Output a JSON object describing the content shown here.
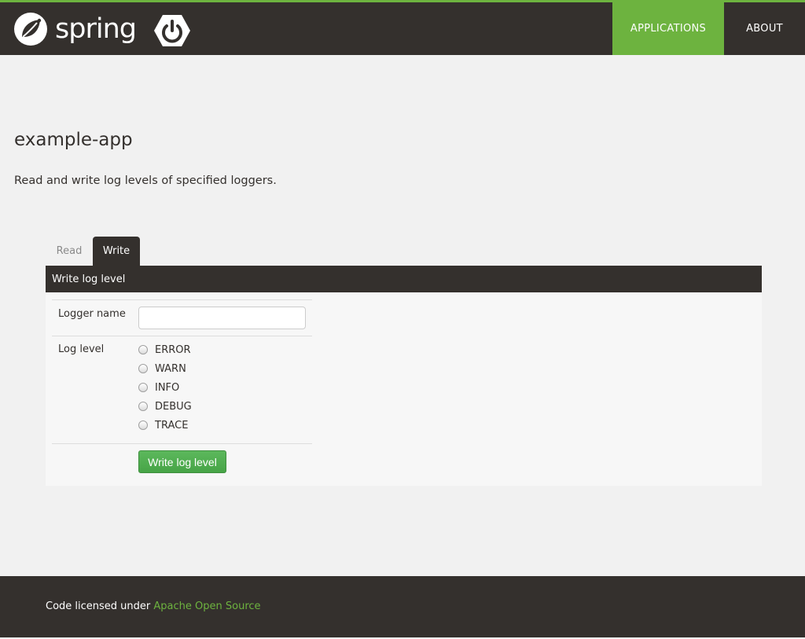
{
  "header": {
    "logo_text": "spring",
    "nav": {
      "applications": "APPLICATIONS",
      "about": "ABOUT"
    },
    "accent_color": "#6db33f",
    "bar_color": "#34302d",
    "icons": [
      "spring-leaf-icon",
      "power-icon"
    ]
  },
  "main": {
    "title": "example-app",
    "description": "Read and write log levels of specified loggers."
  },
  "tabs": {
    "read": "Read",
    "write": "Write",
    "active": "Write"
  },
  "panel": {
    "heading": "Write log level",
    "logger_name_label": "Logger name",
    "logger_name_value": "",
    "log_level_label": "Log level",
    "levels": [
      "ERROR",
      "WARN",
      "INFO",
      "DEBUG",
      "TRACE"
    ],
    "submit_label": "Write log level"
  },
  "footer": {
    "prefix": "Code licensed under ",
    "link": "Apache Open Source"
  }
}
